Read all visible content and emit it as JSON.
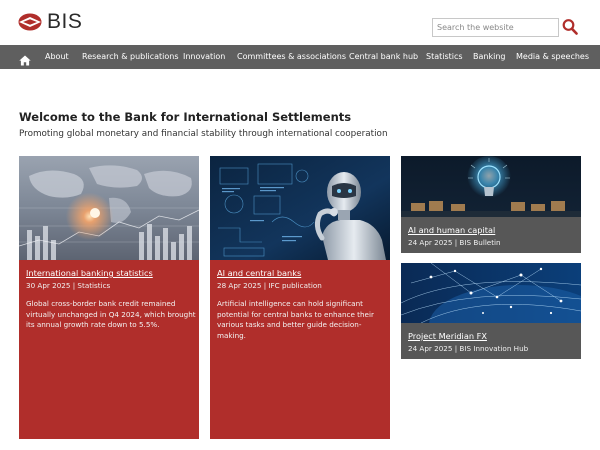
{
  "header": {
    "logo_text": "BIS",
    "search_placeholder": "Search the website"
  },
  "nav": {
    "items": [
      "About",
      "Research & publications",
      "Innovation",
      "Committees & associations",
      "Central bank hub",
      "Statistics",
      "Banking",
      "Media & speeches"
    ]
  },
  "intro": {
    "title": "Welcome to the Bank for International Settlements",
    "subtitle": "Promoting global monetary and financial stability through international cooperation"
  },
  "cards": [
    {
      "title": "International banking statistics",
      "meta": "30 Apr 2025 | Statistics",
      "description": "Global cross-border bank credit remained virtually unchanged in Q4 2024, which brought its annual growth rate down to 5.5%."
    },
    {
      "title": "AI and central banks",
      "meta": "28 Apr 2025 | IFC publication",
      "description": "Artificial intelligence can hold significant potential for central banks to enhance their various tasks and better guide decision-making."
    },
    {
      "title": "AI and human capital",
      "meta": "24 Apr 2025 | BIS Bulletin"
    },
    {
      "title": "Project Meridian FX",
      "meta": "24 Apr 2025 | BIS Innovation Hub"
    }
  ],
  "colors": {
    "nav_bg": "#5f5f5f",
    "card_red": "#b02e2b",
    "card_grey": "#575757",
    "accent": "#b02e2b"
  }
}
